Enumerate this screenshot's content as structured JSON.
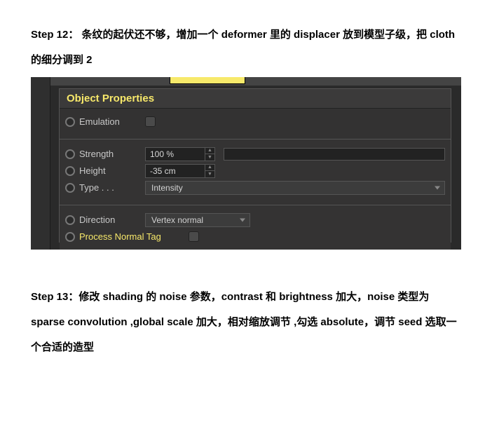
{
  "doc": {
    "step12": "Step 12： 条纹的起伏还不够，增加一个 deformer 里的 displacer 放到模型子级，把 cloth 的细分调到 2",
    "step13": "Step 13：修改 shading 的 noise 参数，contrast 和 brightness 加大，noise 类型为 sparse convolution ,global scale 加大，相对缩放调节 ,勾选 absolute，调节 seed 选取一个合适的造型"
  },
  "panel": {
    "header": "Object Properties",
    "emulation_label": "Emulation",
    "strength_label": "Strength",
    "strength_value": "100 %",
    "height_label": "Height",
    "height_value": "-35 cm",
    "type_label": "Type . . .",
    "type_value": "Intensity",
    "direction_label": "Direction",
    "direction_value": "Vertex normal",
    "processnormal_label": "Process Normal Tag"
  }
}
